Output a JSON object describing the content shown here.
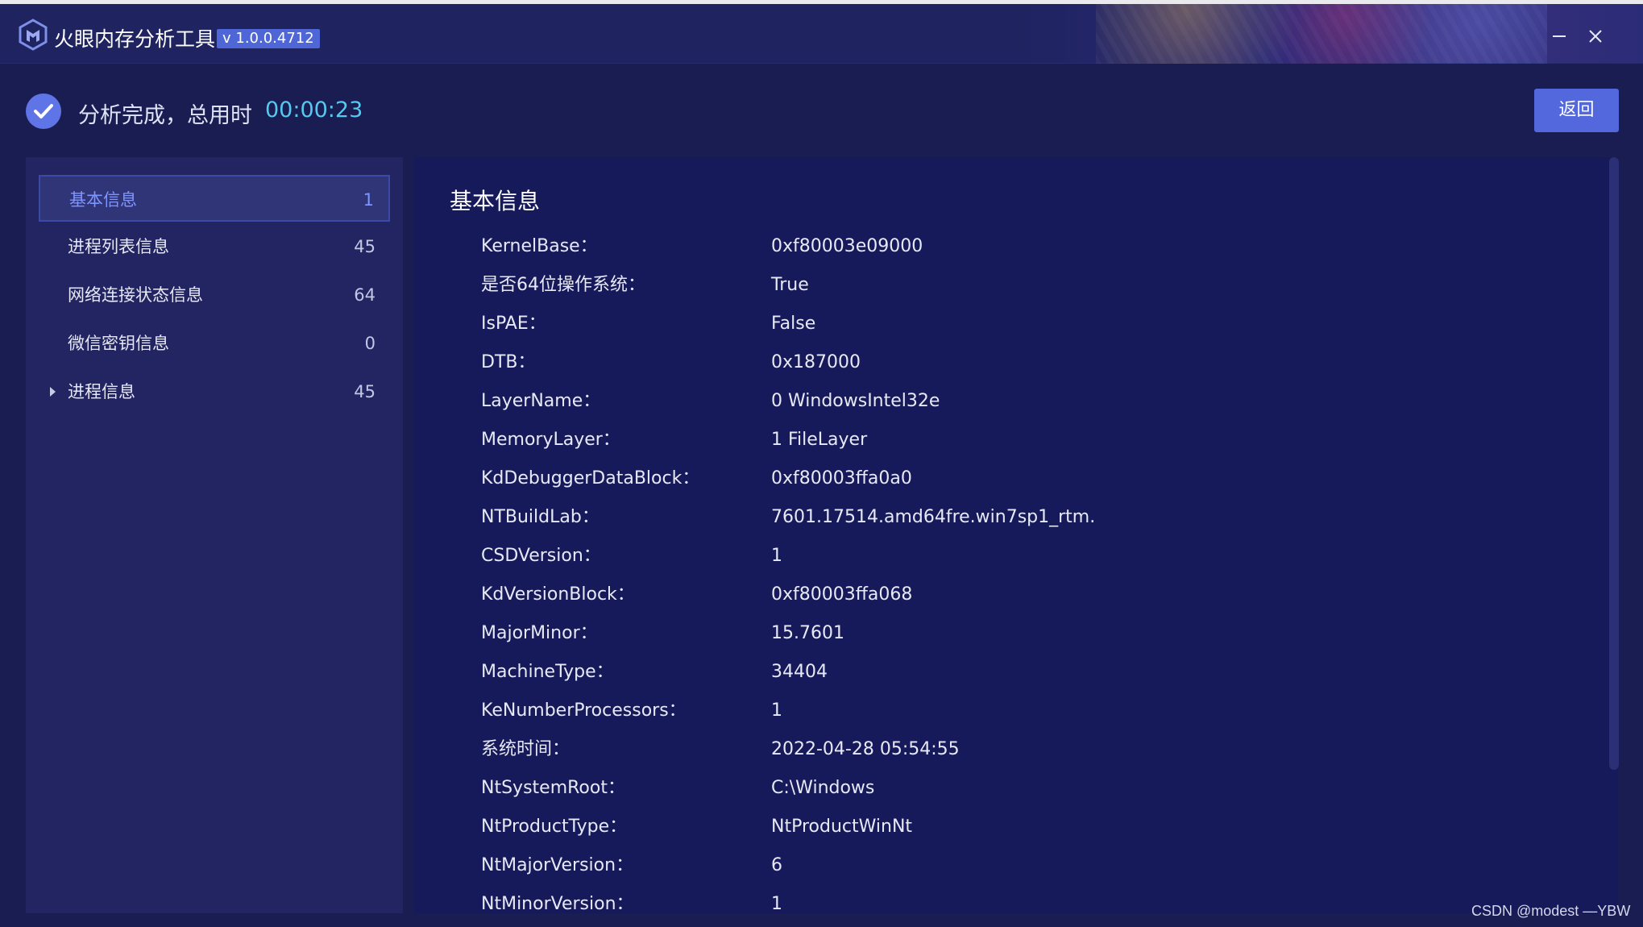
{
  "window": {
    "app_title": "火眼内存分析工具",
    "version": "v 1.0.0.4712"
  },
  "status": {
    "text": "分析完成，总用时",
    "time": "00:00:23",
    "back_label": "返回"
  },
  "sidebar": {
    "items": [
      {
        "label": "基本信息",
        "count": "1"
      },
      {
        "label": "进程列表信息",
        "count": "45"
      },
      {
        "label": "网络连接状态信息",
        "count": "64"
      },
      {
        "label": "微信密钥信息",
        "count": "0"
      },
      {
        "label": "进程信息",
        "count": "45"
      }
    ]
  },
  "main": {
    "title": "基本信息",
    "rows": [
      {
        "key": "KernelBase：",
        "value": "0xf80003e09000"
      },
      {
        "key": "是否64位操作系统：",
        "value": "True"
      },
      {
        "key": "IsPAE：",
        "value": "False"
      },
      {
        "key": "DTB：",
        "value": "0x187000"
      },
      {
        "key": "LayerName：",
        "value": "0 WindowsIntel32e"
      },
      {
        "key": "MemoryLayer：",
        "value": "1 FileLayer"
      },
      {
        "key": "KdDebuggerDataBlock：",
        "value": "0xf80003ffa0a0"
      },
      {
        "key": "NTBuildLab：",
        "value": "7601.17514.amd64fre.win7sp1_rtm."
      },
      {
        "key": "CSDVersion：",
        "value": "1"
      },
      {
        "key": "KdVersionBlock：",
        "value": "0xf80003ffa068"
      },
      {
        "key": "MajorMinor：",
        "value": "15.7601"
      },
      {
        "key": "MachineType：",
        "value": "34404"
      },
      {
        "key": "KeNumberProcessors：",
        "value": "1"
      },
      {
        "key": "系统时间：",
        "value": "2022-04-28 05:54:55"
      },
      {
        "key": "NtSystemRoot：",
        "value": "C:\\Windows"
      },
      {
        "key": "NtProductType：",
        "value": "NtProductWinNt"
      },
      {
        "key": "NtMajorVersion：",
        "value": "6"
      },
      {
        "key": "NtMinorVersion：",
        "value": "1"
      }
    ]
  },
  "watermark": "CSDN @modest —YBW",
  "colors": {
    "background": "#1a1d52",
    "accent": "#5368dc",
    "time_color": "#56c9ef",
    "active_nav_text": "#7e94ff"
  },
  "icons": {
    "logo": "app-logo-icon",
    "status": "check-circle-icon",
    "minimize": "minimize-icon",
    "close": "close-icon",
    "expand": "caret-right-icon"
  }
}
